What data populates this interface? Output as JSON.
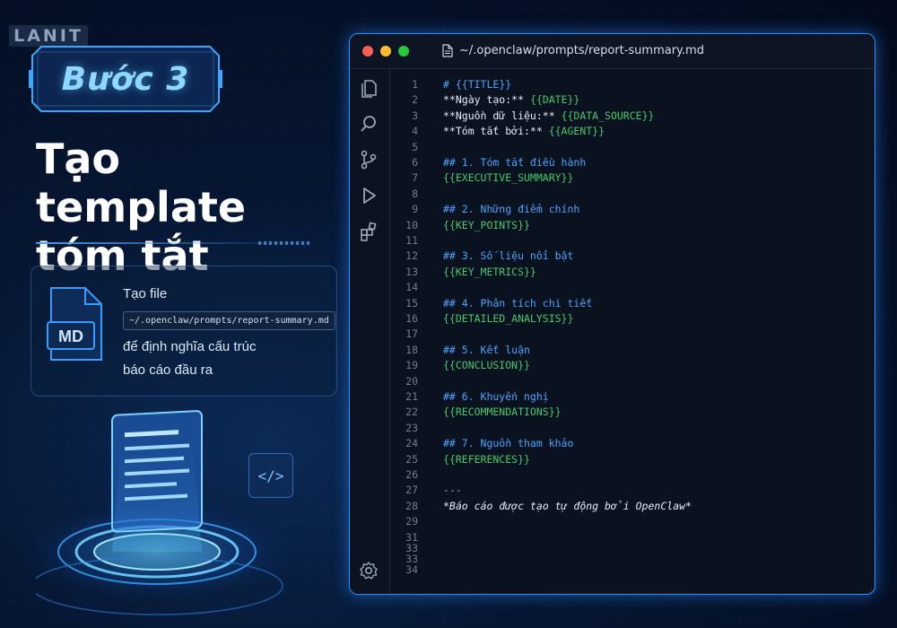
{
  "brand": {
    "logo": "LANIT"
  },
  "step": {
    "label": "Bước 3"
  },
  "title": {
    "line1": "Tạo template",
    "line2": "tóm tắt"
  },
  "info": {
    "icon_label": "MD",
    "line1": "Tạo file",
    "path": "~/.openclaw/prompts/report-summary.md",
    "line3": "để định nghĩa cấu trúc",
    "line4": "báo cáo đầu ra"
  },
  "deco": {
    "code_icon": "</>"
  },
  "editor": {
    "file_path": "~/.openclaw/prompts/report-summary.md",
    "activity_icons": [
      "files-icon",
      "search-icon",
      "source-control-icon",
      "run-icon",
      "extensions-icon",
      "settings-icon"
    ],
    "lines": [
      {
        "n": "1",
        "parts": [
          {
            "t": "# ",
            "c": "head"
          },
          {
            "t": "{{TITLE}}",
            "c": "head"
          }
        ]
      },
      {
        "n": "2",
        "parts": [
          {
            "t": "**Ngày tạo:** ",
            "c": "text"
          },
          {
            "t": "{{DATE}}",
            "c": "var"
          }
        ]
      },
      {
        "n": "3",
        "parts": [
          {
            "t": "**Nguồn dữ liệu:** ",
            "c": "text"
          },
          {
            "t": "{{DATA_SOURCE}}",
            "c": "var"
          }
        ]
      },
      {
        "n": "4",
        "parts": [
          {
            "t": "**Tóm tắt bởi:** ",
            "c": "text"
          },
          {
            "t": "{{AGENT}}",
            "c": "var"
          }
        ]
      },
      {
        "n": "5",
        "parts": []
      },
      {
        "n": "6",
        "parts": [
          {
            "t": "## 1. Tóm tắt điều hành",
            "c": "head"
          }
        ]
      },
      {
        "n": "7",
        "parts": [
          {
            "t": "{{EXECUTIVE_SUMMARY}}",
            "c": "var"
          }
        ]
      },
      {
        "n": "8",
        "parts": []
      },
      {
        "n": "9",
        "parts": [
          {
            "t": "## 2. Những điểm chính",
            "c": "head"
          }
        ]
      },
      {
        "n": "10",
        "parts": [
          {
            "t": "{{KEY_POINTS}}",
            "c": "var"
          }
        ]
      },
      {
        "n": "11",
        "parts": []
      },
      {
        "n": "12",
        "parts": [
          {
            "t": "## 3. Số liệu nổi bật",
            "c": "head"
          }
        ]
      },
      {
        "n": "13",
        "parts": [
          {
            "t": "{{KEY_METRICS}}",
            "c": "var"
          }
        ]
      },
      {
        "n": "14",
        "parts": []
      },
      {
        "n": "15",
        "parts": [
          {
            "t": "## 4. Phân tích chi tiết",
            "c": "head"
          }
        ]
      },
      {
        "n": "16",
        "parts": [
          {
            "t": "{{DETAILED_ANALYSIS}}",
            "c": "var"
          }
        ]
      },
      {
        "n": "17",
        "parts": []
      },
      {
        "n": "18",
        "parts": [
          {
            "t": "## 5. Kết luận",
            "c": "head"
          }
        ]
      },
      {
        "n": "19",
        "parts": [
          {
            "t": "{{CONCLUSION}}",
            "c": "var"
          }
        ]
      },
      {
        "n": "20",
        "parts": []
      },
      {
        "n": "21",
        "parts": [
          {
            "t": "## 6. Khuyến nghị",
            "c": "head"
          }
        ]
      },
      {
        "n": "22",
        "parts": [
          {
            "t": "{{RECOMMENDATIONS}}",
            "c": "var"
          }
        ]
      },
      {
        "n": "23",
        "parts": []
      },
      {
        "n": "24",
        "parts": [
          {
            "t": "## 7. Nguồn tham khảo",
            "c": "head"
          }
        ]
      },
      {
        "n": "25",
        "parts": [
          {
            "t": "{{REFERENCES}}",
            "c": "var"
          }
        ]
      },
      {
        "n": "26",
        "parts": []
      },
      {
        "n": "27",
        "parts": [
          {
            "t": "---",
            "c": "rule"
          }
        ]
      },
      {
        "n": "28",
        "parts": [
          {
            "t": "*Báo cáo được tạo tự động bởi OpenClaw*",
            "c": "ital"
          }
        ]
      },
      {
        "n": "29",
        "parts": []
      },
      {
        "n": "31",
        "parts": []
      },
      {
        "n": "33",
        "parts": []
      },
      {
        "n": "33",
        "parts": []
      },
      {
        "n": "34",
        "parts": []
      }
    ]
  },
  "colors": {
    "accent": "#2f8cff",
    "heading": "#4aa3ff",
    "variable": "#43c96d",
    "background": "#061632"
  }
}
